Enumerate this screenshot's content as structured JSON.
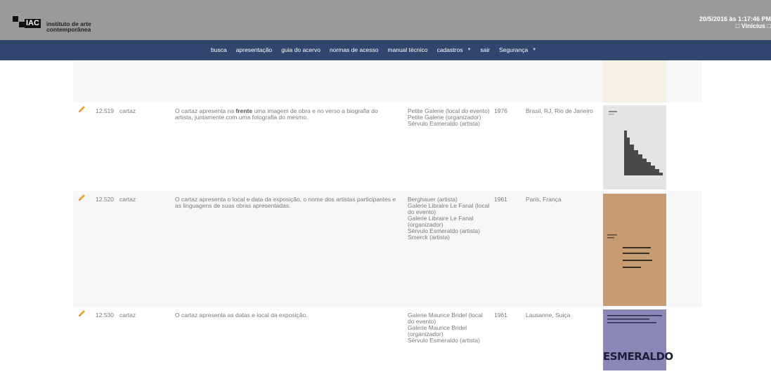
{
  "header": {
    "logo_abbr": "IAC",
    "logo_line1": "instituto de arte",
    "logo_line2": "contemporânea",
    "datetime": "20/5/2016 às 1:17:46 PM",
    "user": "□ Vinicius □"
  },
  "nav": {
    "items": [
      {
        "label": "busca"
      },
      {
        "label": "apresentação"
      },
      {
        "label": "guia do acervo"
      },
      {
        "label": "normas de acesso"
      },
      {
        "label": "manual técnico"
      },
      {
        "label": "cadastros",
        "caret": "▼"
      },
      {
        "label": "sair"
      },
      {
        "label": "Segurança",
        "caret": "▼"
      }
    ]
  },
  "rows": [
    {
      "id": "12.519",
      "type": "cartaz",
      "description": "O cartaz apresenta na frente uma imagem de obra e no verso a biografia do artista, juntamente com uma fotografia do mesmo.",
      "description_bold_word": "frente",
      "people": [
        "Petite Galerie (local do evento)",
        "Petite Galerie (organizador)",
        "Sérvulo Esmeraldo (artista)"
      ],
      "year": "1976",
      "place": "Brasil, RJ, Rio de Janeiro",
      "thumb_colors": {
        "bg": "#e4e4e6",
        "shape": "#4a4a4a"
      }
    },
    {
      "id": "12.520",
      "type": "cartaz",
      "description": "O cartaz apresenta o local e data da exposição, o nome dos artistas participantes e as linguagens de suas obras apresentadas.",
      "people": [
        "Berghauer (artista)",
        "Galerie Libraire Le Fanal (local do evento)",
        "Galerie Libraire Le Fanal (organizador)",
        "Sérvulo Esmeraldo (artista)",
        "Smerck (artista)"
      ],
      "year": "1961",
      "place": "Paris, França",
      "thumb_colors": {
        "bg": "#c9a07a",
        "shape": "#3a2e24"
      }
    },
    {
      "id": "12.530",
      "type": "cartaz",
      "description": "O cartaz apresenta as datas e local da exposição.",
      "people": [
        "Galerie Maurice Bridel (local do evento)",
        "Galerie Maurice Bridel (organizador)",
        "Sérvulo Esmeraldo (artista)"
      ],
      "year": "1961",
      "place": "Lausanne, Suiça",
      "thumb_colors": {
        "bg": "#8b8ab8",
        "shape": "#1d1f3a"
      },
      "thumb_title": "ESMERALDO"
    }
  ],
  "icons": {
    "edit": "pencil-icon"
  },
  "colors": {
    "navbar": "#31456e",
    "header": "#9a9a9a",
    "pencil": "#e8a53a"
  }
}
